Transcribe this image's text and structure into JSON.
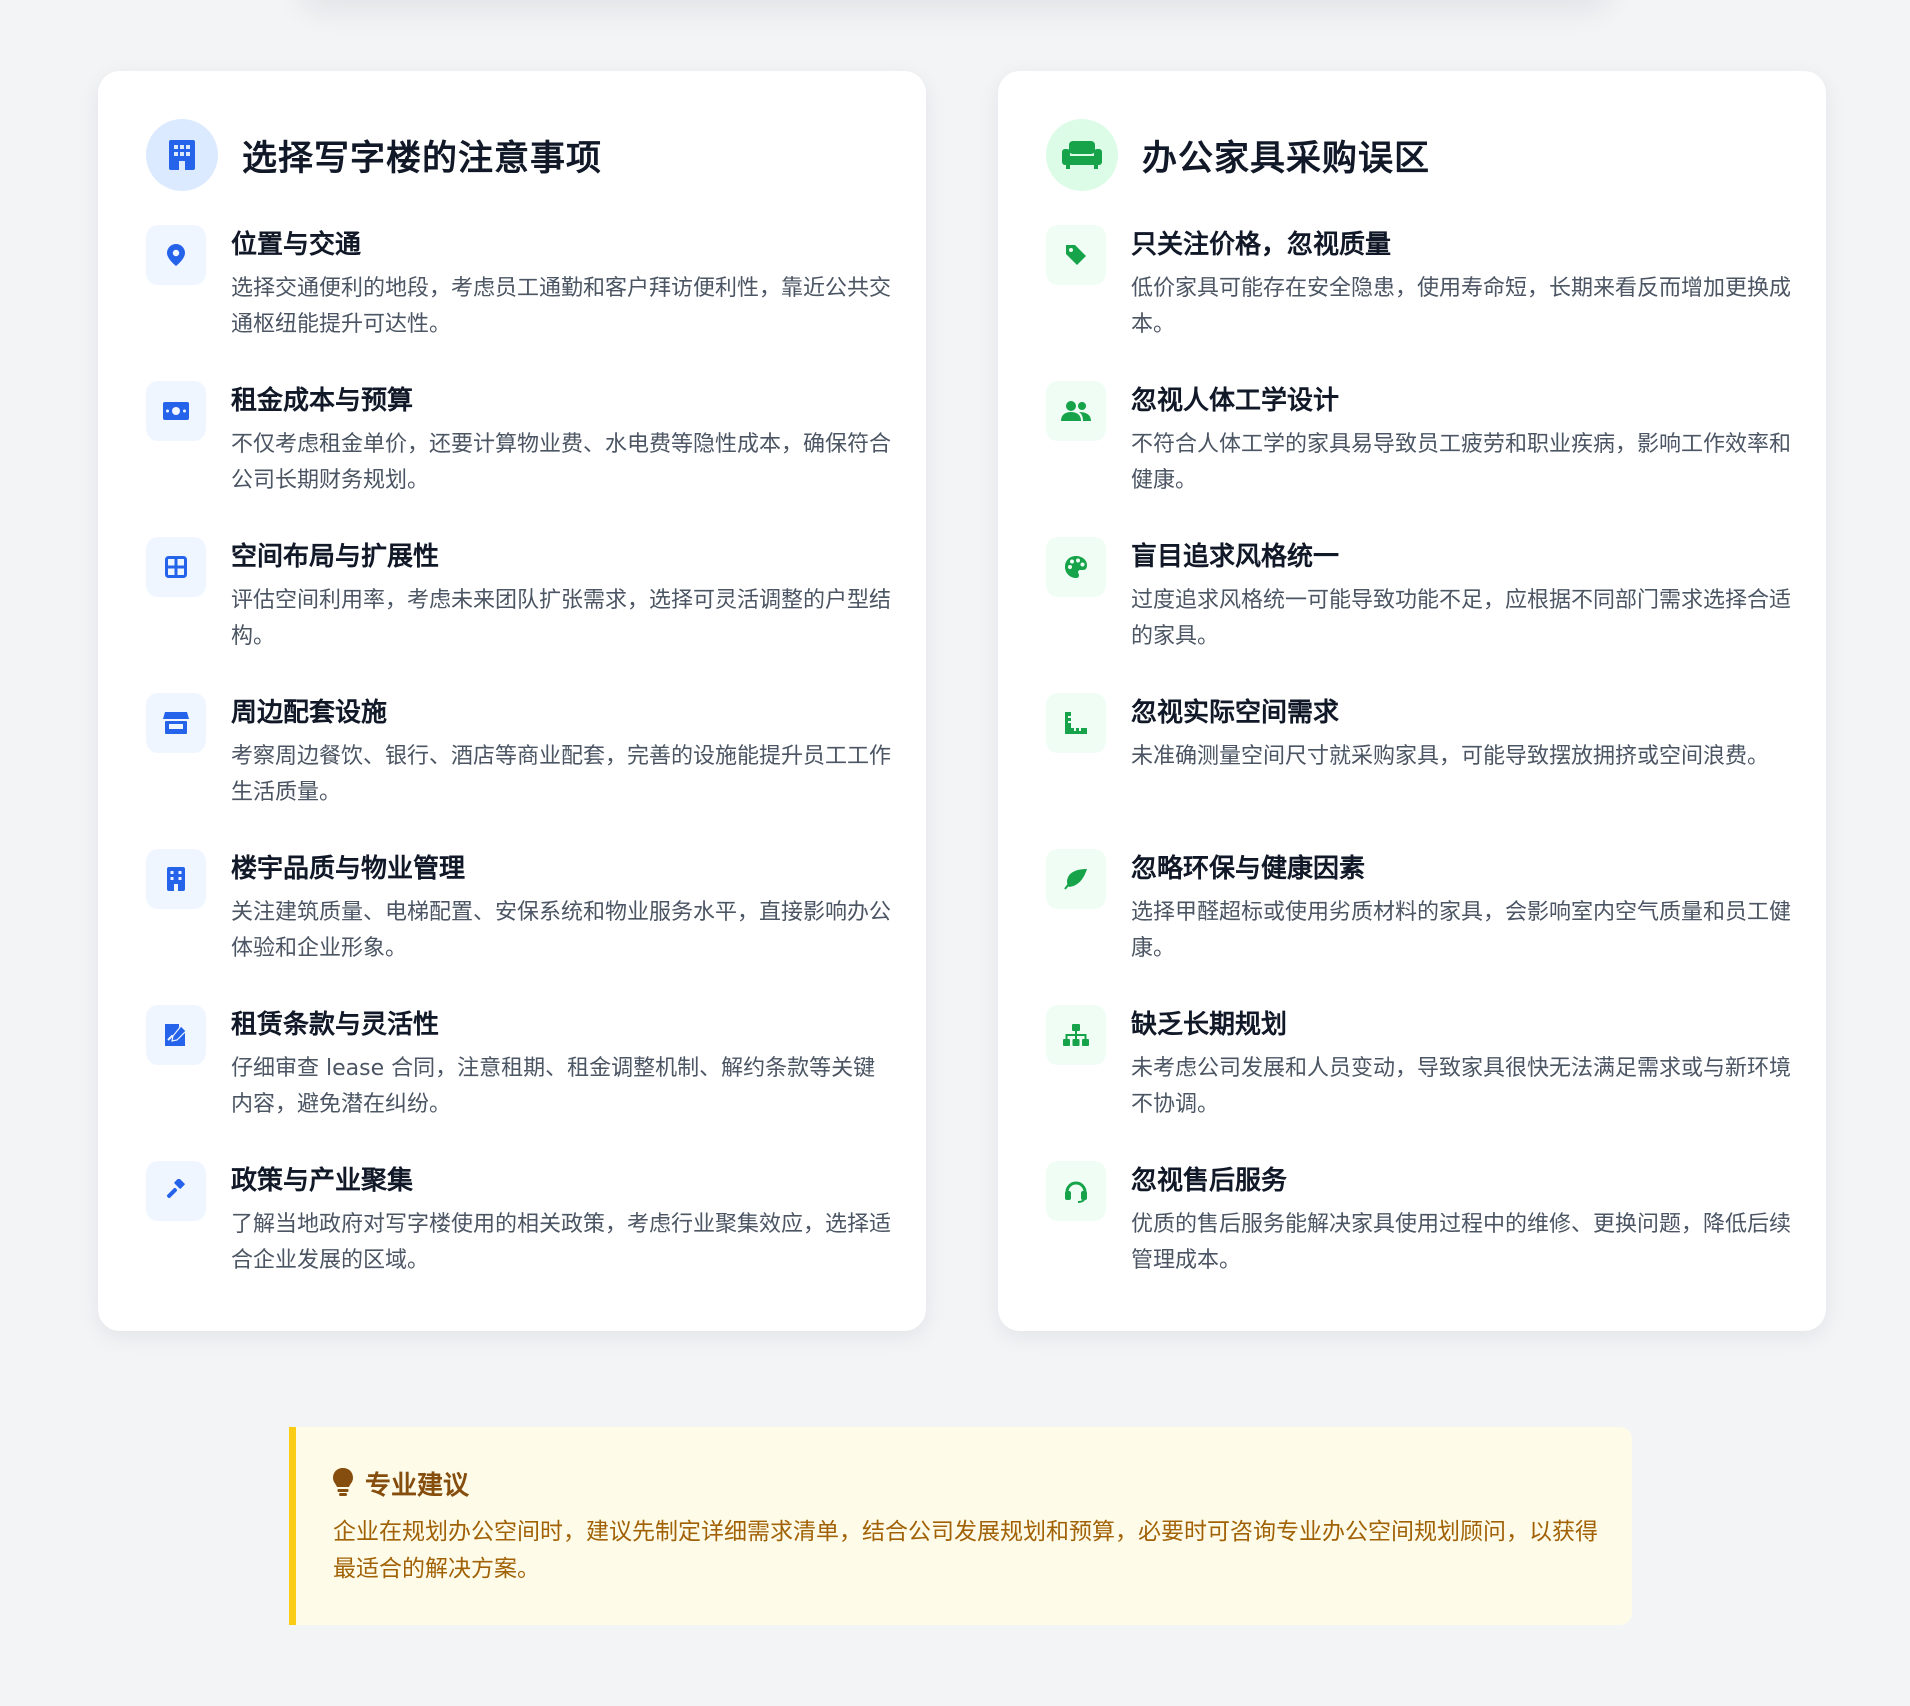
{
  "colors": {
    "page_bg": "#f3f4f6",
    "blue_accent": "#2563eb",
    "green_accent": "#16a34a",
    "tip_accent": "#facc15",
    "tip_text": "#a16207"
  },
  "office_card": {
    "title": "选择写字楼的注意事项",
    "icon": "building-icon",
    "items": [
      {
        "icon": "location-pin-icon",
        "title": "位置与交通",
        "desc": "选择交通便利的地段，考虑员工通勤和客户拜访便利性，靠近公共交通枢纽能提升可达性。"
      },
      {
        "icon": "money-bill-icon",
        "title": "租金成本与预算",
        "desc": "不仅考虑租金单价，还要计算物业费、水电费等隐性成本，确保符合公司长期财务规划。"
      },
      {
        "icon": "layout-grid-icon",
        "title": "空间布局与扩展性",
        "desc": "评估空间利用率，考虑未来团队扩张需求，选择可灵活调整的户型结构。"
      },
      {
        "icon": "store-icon",
        "title": "周边配套设施",
        "desc": "考察周边餐饮、银行、酒店等商业配套，完善的设施能提升员工工作生活质量。"
      },
      {
        "icon": "building-icon",
        "title": "楼宇品质与物业管理",
        "desc": "关注建筑质量、电梯配置、安保系统和物业服务水平，直接影响办公体验和企业形象。"
      },
      {
        "icon": "contract-sign-icon",
        "title": "租赁条款与灵活性",
        "desc": "仔细审查 lease 合同，注意租期、租金调整机制、解约条款等关键内容，避免潜在纠纷。"
      },
      {
        "icon": "gavel-icon",
        "title": "政策与产业聚集",
        "desc": "了解当地政府对写字楼使用的相关政策，考虑行业聚集效应，选择适合企业发展的区域。"
      }
    ]
  },
  "furniture_card": {
    "title": "办公家具采购误区",
    "icon": "couch-icon",
    "items": [
      {
        "icon": "price-tag-icon",
        "title": "只关注价格，忽视质量",
        "desc": "低价家具可能存在安全隐患，使用寿命短，长期来看反而增加更换成本。"
      },
      {
        "icon": "users-icon",
        "title": "忽视人体工学设计",
        "desc": "不符合人体工学的家具易导致员工疲劳和职业疾病，影响工作效率和健康。"
      },
      {
        "icon": "palette-icon",
        "title": "盲目追求风格统一",
        "desc": "过度追求风格统一可能导致功能不足，应根据不同部门需求选择合适的家具。"
      },
      {
        "icon": "ruler-icon",
        "title": "忽视实际空间需求",
        "desc": "未准确测量空间尺寸就采购家具，可能导致摆放拥挤或空间浪费。"
      },
      {
        "icon": "leaf-icon",
        "title": "忽略环保与健康因素",
        "desc": "选择甲醛超标或使用劣质材料的家具，会影响室内空气质量和员工健康。"
      },
      {
        "icon": "sitemap-icon",
        "title": "缺乏长期规划",
        "desc": "未考虑公司发展和人员变动，导致家具很快无法满足需求或与新环境不协调。"
      },
      {
        "icon": "headset-icon",
        "title": "忽视售后服务",
        "desc": "优质的售后服务能解决家具使用过程中的维修、更换问题，降低后续管理成本。"
      }
    ]
  },
  "tip": {
    "icon": "lightbulb-icon",
    "title": "专业建议",
    "text": "企业在规划办公空间时，建议先制定详细需求清单，结合公司发展规划和预算，必要时可咨询专业办公空间规划顾问，以获得最适合的解决方案。"
  }
}
